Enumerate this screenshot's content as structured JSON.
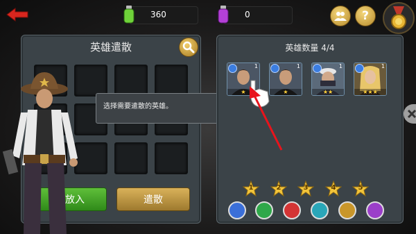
{
  "resources": {
    "green_value": "360",
    "purple_value": "0"
  },
  "left_panel": {
    "title": "英雄遣散",
    "confirm_label": "速放入",
    "dismiss_label": "遣散"
  },
  "tooltip": {
    "text": "选择需要遣散的英雄。"
  },
  "right_panel": {
    "title": "英雄数量 4/4",
    "heroes": [
      {
        "level": "1",
        "stars": "★"
      },
      {
        "level": "1",
        "stars": "★"
      },
      {
        "level": "1",
        "stars": "★★"
      },
      {
        "level": "1",
        "stars": "★★★"
      }
    ],
    "star_filters": [
      "1",
      "2",
      "3",
      "4",
      "5"
    ]
  },
  "colors": {
    "accent_gold": "#d9b15a",
    "confirm_green": "#4aa82a",
    "arrow_red": "#e8141c"
  }
}
